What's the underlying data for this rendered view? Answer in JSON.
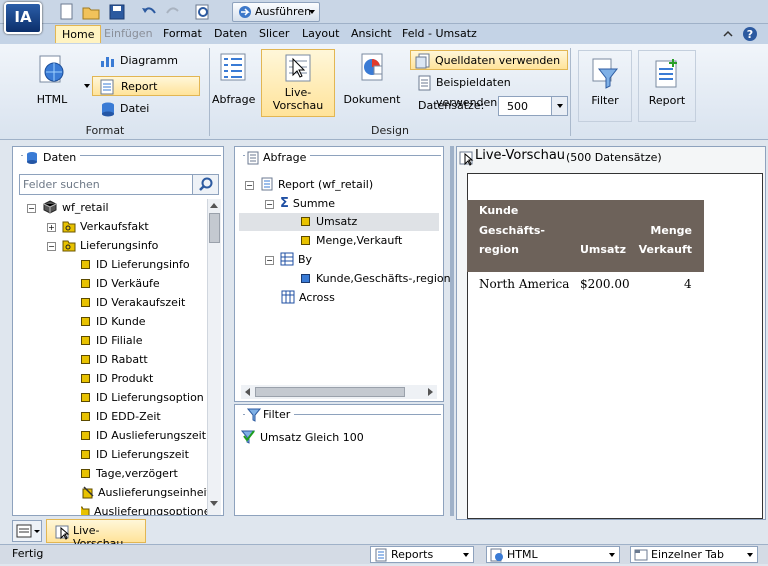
{
  "quick_access": {
    "run_label": "Ausführen"
  },
  "logo": {
    "text": "IA"
  },
  "menu_tabs": [
    {
      "label": "Home",
      "active": true
    },
    {
      "label": "Einfügen",
      "disabled": true
    },
    {
      "label": "Format"
    },
    {
      "label": "Daten"
    },
    {
      "label": "Slicer"
    },
    {
      "label": "Layout"
    },
    {
      "label": "Ansicht"
    },
    {
      "label": "Feld - Umsatz"
    }
  ],
  "ribbon": {
    "format_group": {
      "label": "Format",
      "html_label": "HTML",
      "diagram_label": "Diagramm",
      "report_label": "Report",
      "datei_label": "Datei"
    },
    "design_group": {
      "label": "Design",
      "abfrage_label": "Abfrage",
      "live_label_1": "Live-",
      "live_label_2": "Vorschau",
      "dokument_label": "Dokument",
      "quelldaten_label": "Quelldaten verwenden",
      "beispieldaten_label": "Beispieldaten verwenden",
      "datensaetze_label": "Datensätze:",
      "datensaetze_value": "500"
    },
    "filter_label": "Filter",
    "report_label": "Report"
  },
  "daten_panel": {
    "title": "Daten",
    "search_placeholder": "Felder suchen",
    "tree": [
      {
        "label": "wf_retail",
        "level": 0,
        "type": "db"
      },
      {
        "label": "Verkaufsfakt",
        "level": 1,
        "type": "folder",
        "expand": "+"
      },
      {
        "label": "Lieferungsinfo",
        "level": 1,
        "type": "folder",
        "expand": "-"
      },
      {
        "label": "ID Lieferungsinfo",
        "level": 2,
        "type": "field"
      },
      {
        "label": "ID Verkäufe",
        "level": 2,
        "type": "field"
      },
      {
        "label": "ID Verakaufszeit",
        "level": 2,
        "type": "field"
      },
      {
        "label": "ID Kunde",
        "level": 2,
        "type": "field"
      },
      {
        "label": "ID Filiale",
        "level": 2,
        "type": "field"
      },
      {
        "label": "ID Rabatt",
        "level": 2,
        "type": "field"
      },
      {
        "label": "ID Produkt",
        "level": 2,
        "type": "field"
      },
      {
        "label": "ID Lieferungsoption",
        "level": 2,
        "type": "field"
      },
      {
        "label": "ID EDD-Zeit",
        "level": 2,
        "type": "field"
      },
      {
        "label": "ID Auslieferungszeit",
        "level": 2,
        "type": "field"
      },
      {
        "label": "ID Lieferungszeit",
        "level": 2,
        "type": "field"
      },
      {
        "label": "Tage,verzögert",
        "level": 2,
        "type": "field"
      },
      {
        "label": "Auslieferungseinheit(",
        "level": 2,
        "type": "field2"
      },
      {
        "label": "Auslieferungsoptione",
        "level": 2,
        "type": "folder2"
      }
    ]
  },
  "abfrage_panel": {
    "title": "Abfrage",
    "report_label": "Report (wf_retail)",
    "summe_label": "Summe",
    "umsatz_label": "Umsatz",
    "menge_label": "Menge,Verkauft",
    "by_label": "By",
    "kunde_label": "Kunde,Geschäfts-,region",
    "across_label": "Across"
  },
  "filter_panel": {
    "title": "Filter",
    "item_label": "Umsatz Gleich 100"
  },
  "preview_panel": {
    "title": "Live-Vorschau",
    "subtitle": "(500 Datensätze)",
    "header_col1_line1": "Kunde",
    "header_col1_line2": "Geschäfts-",
    "header_col1_line3": "region",
    "header_col2": "Umsatz",
    "header_col3_line1": "Menge",
    "header_col3_line2": "Verkauft",
    "row": {
      "region": "North America",
      "umsatz": "$200.00",
      "menge": "4"
    }
  },
  "bottom_tab": {
    "label": "Live-Vorschau"
  },
  "statusbar": {
    "status": "Fertig",
    "combo1": "Reports",
    "combo2": "HTML",
    "combo3": "Einzelner Tab"
  }
}
